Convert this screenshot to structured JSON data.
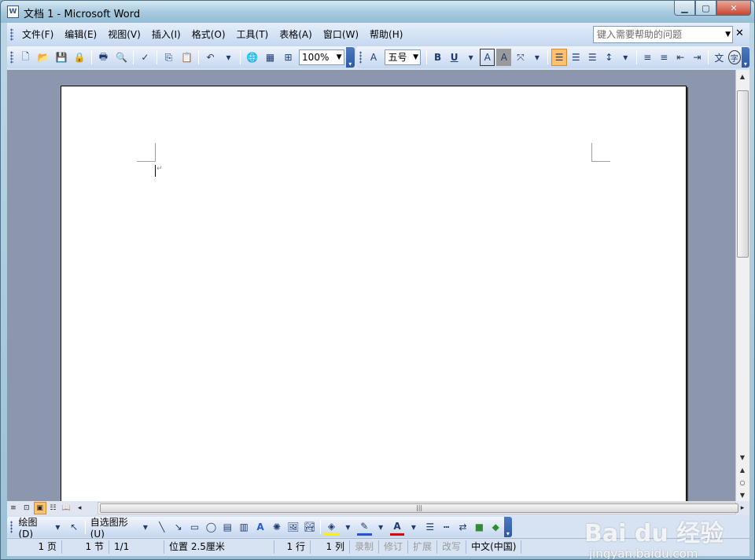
{
  "window": {
    "title": "文档 1 - Microsoft Word",
    "minimize_glyph": "▁",
    "maximize_glyph": "▢",
    "close_glyph": "✕"
  },
  "menubar": {
    "items": [
      {
        "label": "文件(F)"
      },
      {
        "label": "编辑(E)"
      },
      {
        "label": "视图(V)"
      },
      {
        "label": "插入(I)"
      },
      {
        "label": "格式(O)"
      },
      {
        "label": "工具(T)"
      },
      {
        "label": "表格(A)"
      },
      {
        "label": "窗口(W)"
      },
      {
        "label": "帮助(H)"
      }
    ],
    "help_placeholder": "键入需要帮助的问题",
    "doc_close_glyph": "✕"
  },
  "standard_toolbar": {
    "zoom": "100%",
    "icons": [
      "new-icon",
      "open-icon",
      "save-icon",
      "permission-icon",
      "print-icon",
      "print-preview-icon",
      "spelling-icon",
      "copy-icon",
      "paste-icon",
      "undo-icon",
      "hyperlink-icon",
      "tables-icon",
      "excel-icon"
    ]
  },
  "formatting_toolbar": {
    "font_size": "五号",
    "bold": "B",
    "underline": "U",
    "char_border": "A",
    "char_shading": "A",
    "phonetic": "文",
    "enclose": "字"
  },
  "drawing_toolbar": {
    "draw_label": "绘图(D)",
    "autoshapes_label": "自选图形(U)",
    "text_color_letter": "A"
  },
  "statusbar": {
    "page": "1 页",
    "section": "1 节",
    "page_of": "1/1",
    "position": "位置 2.5厘米",
    "line": "1 行",
    "column": "1 列",
    "rec": "录制",
    "trk": "修订",
    "ext": "扩展",
    "ovr": "改写",
    "language": "中文(中国)"
  },
  "watermark": {
    "brand": "Bai du 经验",
    "url": "jingyan.baidu.com"
  },
  "colors": {
    "accent_active": "#ffc16e",
    "toolbar_blue": "#c5d7f0",
    "doc_background": "#8c96ad"
  }
}
